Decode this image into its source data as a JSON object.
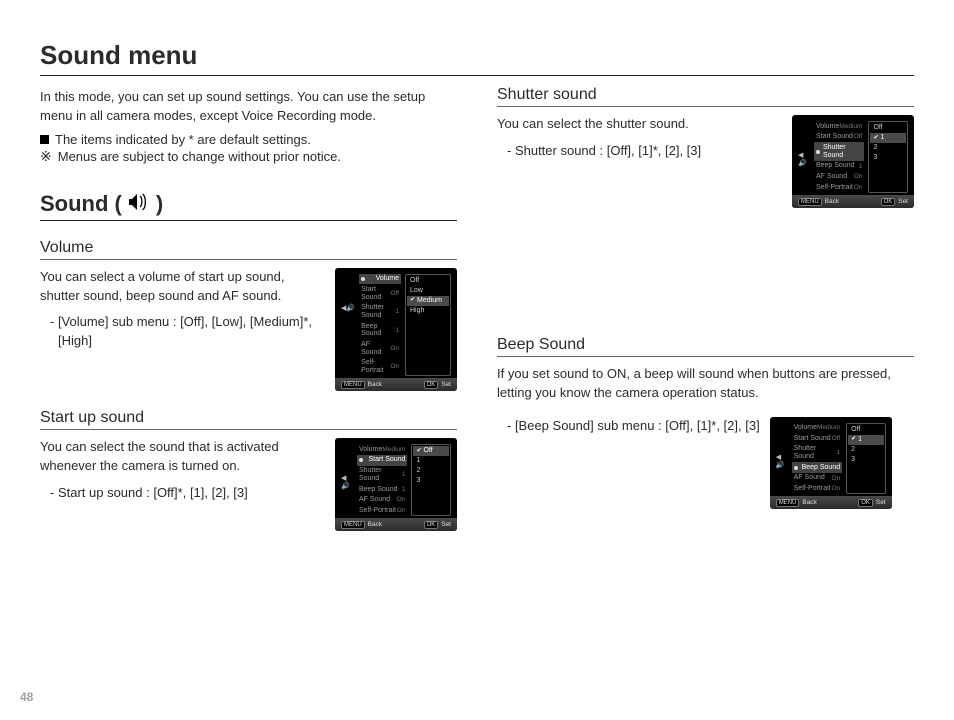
{
  "page_number": "48",
  "headings": {
    "sound_menu": "Sound menu",
    "sound": "Sound (",
    "sound_close": " )",
    "volume": "Volume",
    "startup": "Start up sound",
    "shutter": "Shutter sound",
    "beep": "Beep Sound"
  },
  "intro": {
    "p1": "In this mode, you can set up sound settings. You can use the setup menu in all camera modes, except Voice Recording mode.",
    "b1": "The items indicated by * are default settings.",
    "b2": "Menus are subject to change without prior notice."
  },
  "volume": {
    "p": "You can select a volume of start up sound, shutter sound, beep sound and AF sound.",
    "sub": "- [Volume] sub menu : [Off], [Low], [Medium]*, [High]"
  },
  "startup": {
    "p": "You can select the sound that is activated whenever the camera is turned on.",
    "sub": "- Start up sound : [Off]*, [1], [2], [3]"
  },
  "shutter": {
    "p": "You can select the shutter sound.",
    "sub": "- Shutter sound : [Off], [1]*, [2], [3]"
  },
  "beep": {
    "p": "If you set sound to ON, a beep will sound when buttons are pressed, letting you know the camera operation status.",
    "sub": "- [Beep Sound] sub menu : [Off], [1]*, [2], [3]"
  },
  "lcd_common": {
    "menu_items": [
      "Volume",
      "Start Sound",
      "Shutter Sound",
      "Beep Sound",
      "AF Sound",
      "Self-Portrait"
    ],
    "right_vals": {
      "Volume": "Medium",
      "Start Sound": "Off",
      "Shutter Sound": "1",
      "Beep Sound": "1",
      "AF Sound": "On",
      "Self-Portrait": "On"
    },
    "footer_back": "Back",
    "footer_set": "Set",
    "footer_menu_tag": "MENU",
    "footer_ok_tag": "OK"
  },
  "lcd_volume_sub": [
    "Off",
    "Low",
    "Medium",
    "High"
  ],
  "lcd_startup_sub": [
    "Off",
    "1",
    "2",
    "3"
  ],
  "lcd_shutter_sub": [
    "Off",
    "1",
    "2",
    "3"
  ],
  "lcd_beep_sub": [
    "Off",
    "1",
    "2",
    "3"
  ],
  "lcd_sel": {
    "volume": {
      "menu": "Volume",
      "sub": "Medium"
    },
    "startup": {
      "menu": "Start Sound",
      "sub": "Off"
    },
    "shutter": {
      "menu": "Shutter Sound",
      "sub": "1"
    },
    "beep": {
      "menu": "Beep Sound",
      "sub": "1"
    }
  }
}
